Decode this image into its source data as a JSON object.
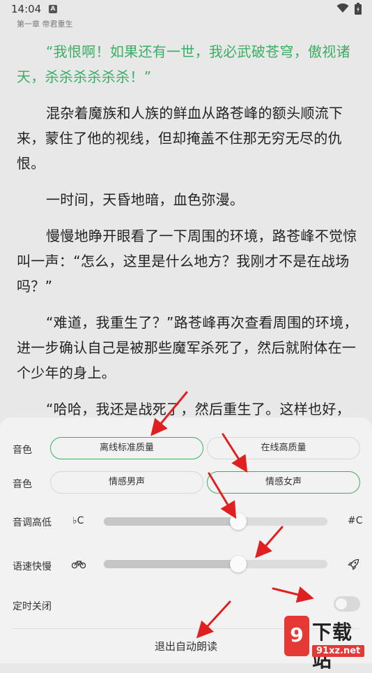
{
  "status_bar": {
    "time": "14:04",
    "notification_badge": "A"
  },
  "chapter_title": "第一章 帝君重生",
  "paragraphs": [
    {
      "text": "“我恨啊！如果还有一世，我必武破苍穹，傲视诸天，杀杀杀杀杀杀！”",
      "highlight": true
    },
    {
      "text": "混杂着魔族和人族的鲜血从路苍峰的额头顺流下来，蒙住了他的视线，但却掩盖不住那无穷无尽的仇恨。",
      "highlight": false
    },
    {
      "text": "一时间，天昏地暗，血色弥漫。",
      "highlight": false
    },
    {
      "text": "慢慢地睁开眼看了一下周围的环境，路苍峰不觉惊叫一声：“怎么，这里是什么地方？我刚才不是在战场吗？”",
      "highlight": false
    },
    {
      "text": "“难道，我重生了？”路苍峰再次查看周围的环境，进一步确认自己是被那些魔军杀死了，然后就附体在一个少年的身上。",
      "highlight": false
    },
    {
      "text": "“哈哈，我还是战死了，然后重生了。这样也好，",
      "highlight": false
    }
  ],
  "panel": {
    "quality_row": {
      "label": "音色",
      "options": [
        "离线标准质量",
        "在线高质量"
      ],
      "selected": 0
    },
    "voice_row": {
      "label": "音色",
      "options": [
        "情感男声",
        "情感女声"
      ],
      "selected": 1
    },
    "pitch": {
      "label": "音调高低",
      "left_icon": "♭C",
      "right_icon": "#C",
      "value": 0.6
    },
    "speed": {
      "label": "语速快慢",
      "left_icon": "bicycle-icon",
      "right_icon": "rocket-icon",
      "value": 0.6
    },
    "timer": {
      "label": "定时关闭",
      "enabled": false
    },
    "exit_label": "退出自动朗读"
  },
  "watermark": {
    "badge": "9",
    "title": "下载站",
    "url": "91xz.net"
  },
  "colors": {
    "accent": "#3aae64",
    "annotation_arrow": "#e02020",
    "watermark_red": "#e53935"
  }
}
